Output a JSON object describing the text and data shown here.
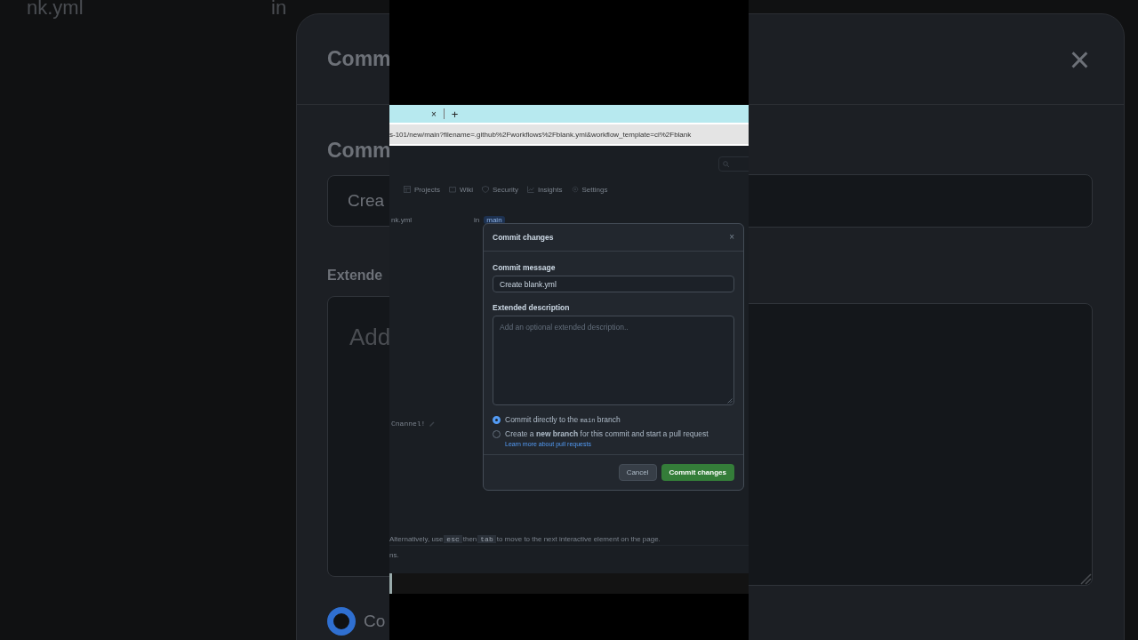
{
  "backdrop": {
    "left": {
      "file": "nk.yml",
      "in": "in",
      "title": "Comm",
      "message_label": "Comm",
      "message_value": "Crea",
      "description_label": "Extende",
      "description_placeholder": "Add",
      "radio": {
        "label": "Co",
        "selected": true
      }
    },
    "right": {
      "close": "×"
    }
  },
  "browser": {
    "tab_close": "×",
    "new_tab": "+",
    "url": "s-101/new/main?filename=.github%2Fworkflows%2Fblank.yml&workflow_template=ci%2Fblank"
  },
  "page": {
    "nav": [
      "Projects",
      "Wiki",
      "Security",
      "Insights",
      "Settings"
    ],
    "file": "nk.yml",
    "in": "in",
    "branch": "main",
    "code_line": "Cnannel!",
    "hint": [
      {
        "kind": "text",
        "text": "Alternatively, use "
      },
      {
        "kind": "code",
        "text": "esc"
      },
      {
        "kind": "text",
        "text": " then "
      },
      {
        "kind": "code",
        "text": "tab"
      },
      {
        "kind": "text",
        "text": " to move to the next interactive element on the page."
      }
    ],
    "hint_end": "ns."
  },
  "dialog": {
    "title": "Commit changes",
    "close": "×",
    "message_label": "Commit message",
    "message_value": "Create blank.yml",
    "description_label": "Extended description",
    "description_placeholder": "Add an optional extended description..",
    "options": [
      {
        "selected": true,
        "parts": [
          {
            "kind": "text",
            "text": "Commit directly to the "
          },
          {
            "kind": "code",
            "text": "main"
          },
          {
            "kind": "text",
            "text": " branch"
          }
        ]
      },
      {
        "selected": false,
        "parts": [
          {
            "kind": "text",
            "text": "Create a **new branch** for this commit and start a pull request"
          }
        ]
      }
    ],
    "link": "Learn more about pull requests",
    "buttons": [
      {
        "kind": "secondary",
        "label": "Cancel"
      },
      {
        "kind": "primary",
        "label": "Commit changes"
      }
    ]
  }
}
